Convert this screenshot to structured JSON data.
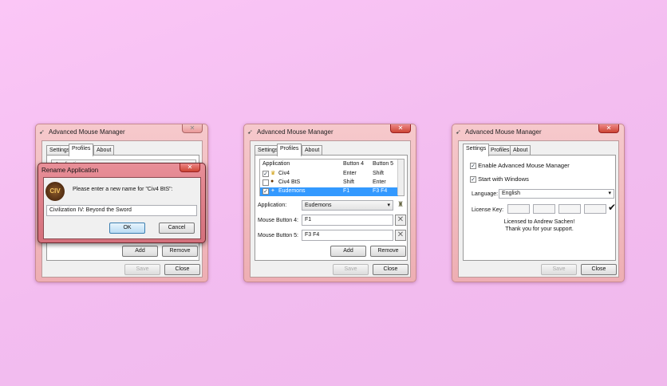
{
  "window_title": "Advanced Mouse Manager",
  "tabs": [
    "Settings",
    "Profiles",
    "About"
  ],
  "buttons": {
    "add": "Add",
    "remove": "Remove",
    "save": "Save",
    "close": "Close",
    "ok": "OK",
    "cancel": "Cancel"
  },
  "list": {
    "headers": [
      "Application",
      "Button 4",
      "Button 5"
    ],
    "rows": [
      {
        "name": "Civ4",
        "b4": "Enter",
        "b5": "Shift",
        "checked": true
      },
      {
        "name": "Civ4 BtS",
        "b4": "Shift",
        "b5": "Enter",
        "checked": false
      },
      {
        "name": "Eudemons",
        "b4": "F1",
        "b5": "F3 F4",
        "checked": true
      }
    ]
  },
  "rename_dialog": {
    "title": "Rename Application",
    "prompt": "Please enter a new name for \"Civ4 BtS\":",
    "value": "Civilization IV: Beyond the Sword",
    "icon_text": "CIV"
  },
  "profiles": {
    "application_label": "Application:",
    "application_value": "Eudemons",
    "mb4_label": "Mouse Button 4:",
    "mb4_value": "F1",
    "mb5_label": "Mouse Button 5:",
    "mb5_value": "F3 F4"
  },
  "settings": {
    "enable_label": "Enable Advanced Mouse Manager",
    "start_label": "Start with Windows",
    "language_label": "Language:",
    "language_value": "English",
    "license_label": "License Key:",
    "licensed_line1": "Licensed to Andrew Sachen!",
    "licensed_line2": "Thank you for your support."
  },
  "colors": {
    "selection": "#3399ff"
  }
}
